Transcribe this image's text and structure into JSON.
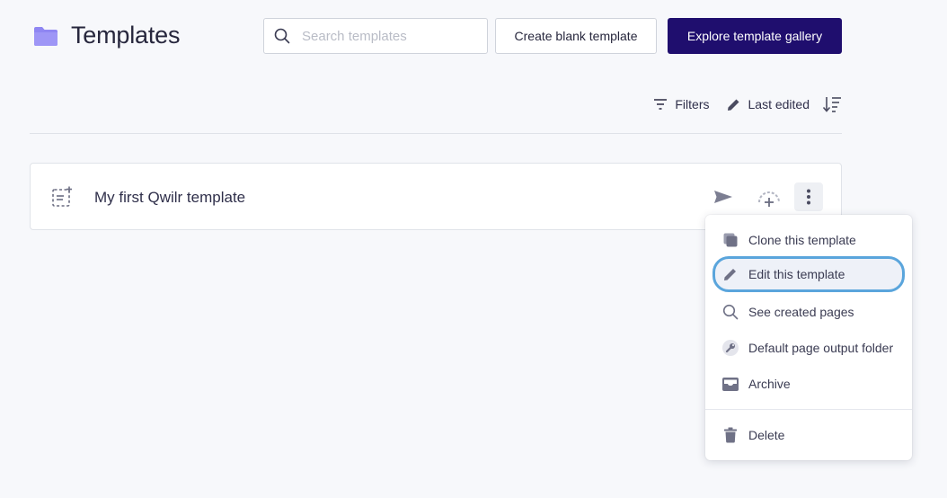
{
  "header": {
    "title": "Templates",
    "search_placeholder": "Search templates",
    "create_blank_label": "Create blank template",
    "explore_gallery_label": "Explore template gallery"
  },
  "toolbar": {
    "filters_label": "Filters",
    "sort_label": "Last edited"
  },
  "templates": [
    {
      "name": "My first Qwilr template"
    }
  ],
  "menu": {
    "items": [
      {
        "label": "Clone this template",
        "icon": "clone-icon"
      },
      {
        "label": "Edit this template",
        "icon": "pencil-icon",
        "active": true
      },
      {
        "label": "See created pages",
        "icon": "search-icon"
      },
      {
        "label": "Default page output folder",
        "icon": "folder-settings-icon"
      },
      {
        "label": "Archive",
        "icon": "archive-icon"
      },
      {
        "label": "Delete",
        "icon": "trash-icon"
      }
    ]
  },
  "colors": {
    "accent": "#1f0e6e",
    "folder": "#8f86f2",
    "focus_ring": "#5aa5dc"
  }
}
